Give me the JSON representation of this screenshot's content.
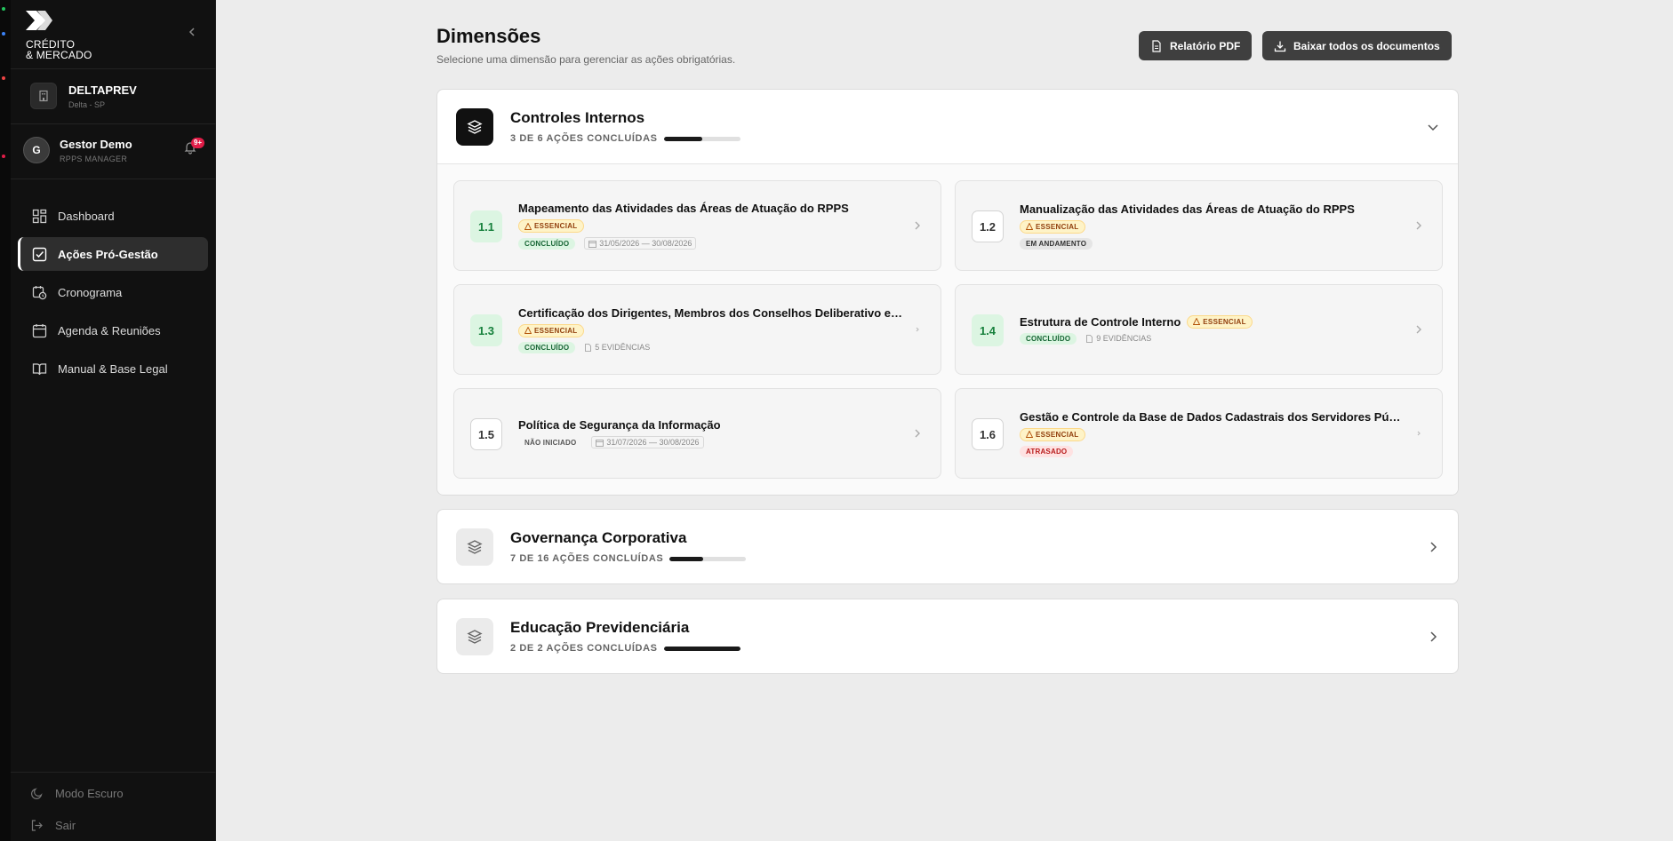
{
  "brand": {
    "line1": "CRÉDITO",
    "line2": "& MERCADO"
  },
  "org": {
    "name": "DELTAPREV",
    "location": "Delta - SP"
  },
  "user": {
    "initial": "G",
    "name": "Gestor Demo",
    "role": "RPPS MANAGER",
    "notifications": "9+"
  },
  "nav": [
    {
      "label": "Dashboard",
      "icon": "grid-icon"
    },
    {
      "label": "Ações Pró-Gestão",
      "icon": "checkbox-icon",
      "active": true
    },
    {
      "label": "Cronograma",
      "icon": "calendar-clock-icon"
    },
    {
      "label": "Agenda & Reuniões",
      "icon": "calendar-icon"
    },
    {
      "label": "Manual & Base Legal",
      "icon": "book-icon"
    }
  ],
  "footer": {
    "dark_mode": "Modo Escuro",
    "logout": "Sair"
  },
  "header": {
    "title": "Dimensões",
    "subtitle": "Selecione uma dimensão para gerenciar as ações obrigatórias.",
    "pdf_button": "Relatório PDF",
    "download_button": "Baixar todos os documentos"
  },
  "dimensions": [
    {
      "title": "Controles Internos",
      "count": "3 DE 6 AÇÕES CONCLUÍDAS",
      "progress": 0.5,
      "expanded": true,
      "actions": [
        {
          "num": "1.1",
          "title": "Mapeamento das Atividades das Áreas de Atuação do RPPS",
          "essential": "ESSENCIAL",
          "status": "CONCLUÍDO",
          "meta": "31/05/2026 — 30/08/2026"
        },
        {
          "num": "1.2",
          "title": "Manualização das Atividades das Áreas de Atuação do RPPS",
          "essential": "ESSENCIAL",
          "status": "EM ANDAMENTO",
          "meta": ""
        },
        {
          "num": "1.3",
          "title": "Certificação dos Dirigentes, Membros dos Conselhos Deliberativo e Fis...",
          "essential": "ESSENCIAL",
          "status": "CONCLUÍDO",
          "meta": "5 EVIDÊNCIAS"
        },
        {
          "num": "1.4",
          "title": "Estrutura de Controle Interno",
          "essential": "ESSENCIAL",
          "status": "CONCLUÍDO",
          "meta": "9 EVIDÊNCIAS"
        },
        {
          "num": "1.5",
          "title": "Política de Segurança da Informação",
          "essential": "",
          "status": "NÃO INICIADO",
          "meta": "31/07/2026 — 30/08/2026"
        },
        {
          "num": "1.6",
          "title": "Gestão e Controle da Base de Dados Cadastrais dos Servidores Públic...",
          "essential": "ESSENCIAL",
          "status": "ATRASADO",
          "meta": ""
        }
      ]
    },
    {
      "title": "Governança Corporativa",
      "count": "7 DE 16 AÇÕES CONCLUÍDAS",
      "progress": 0.4375,
      "expanded": false
    },
    {
      "title": "Educação Previdenciária",
      "count": "2 DE 2 AÇÕES CONCLUÍDAS",
      "progress": 1.0,
      "expanded": false
    }
  ]
}
